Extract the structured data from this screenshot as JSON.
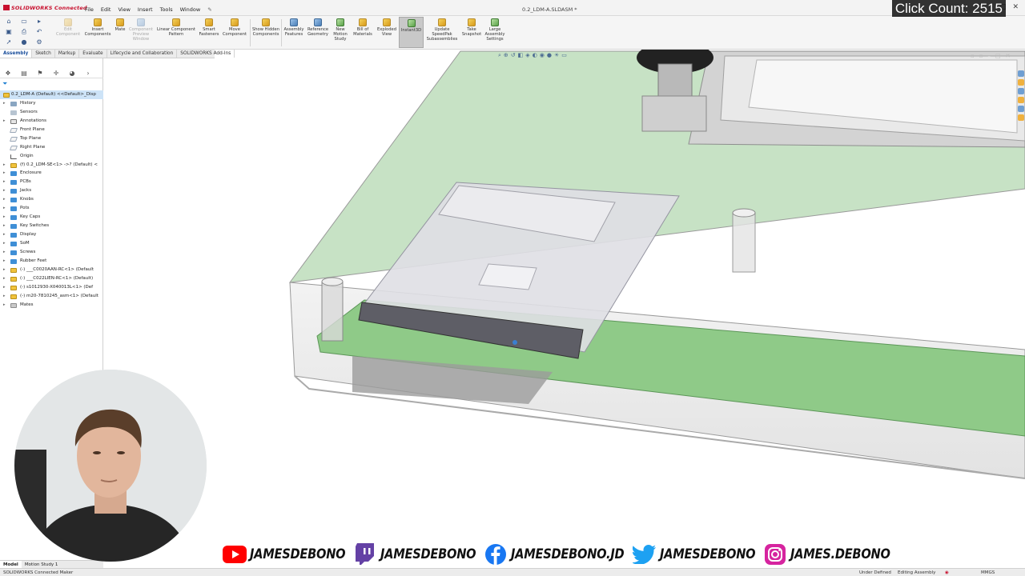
{
  "app": {
    "brand": "SOLIDWORKS Connected",
    "document_title": "0.2_LDM-A.SLDASM *",
    "menus": [
      "File",
      "Edit",
      "View",
      "Insert",
      "Tools",
      "Window"
    ]
  },
  "overlay": {
    "click_count": "Click Count: 2515"
  },
  "command_manager": {
    "buttons": [
      {
        "label": "Edit Component",
        "enabled": false
      },
      {
        "label": "Insert Components",
        "enabled": true
      },
      {
        "label": "Mate",
        "enabled": true
      },
      {
        "label": "Component Preview Window",
        "enabled": false
      },
      {
        "label": "Linear Component Pattern",
        "enabled": true
      },
      {
        "label": "Smart Fasteners",
        "enabled": true
      },
      {
        "label": "Move Component",
        "enabled": true
      },
      {
        "label": "Show Hidden Components",
        "enabled": true
      },
      {
        "label": "Assembly Features",
        "enabled": true
      },
      {
        "label": "Reference Geometry",
        "enabled": true
      },
      {
        "label": "New Motion Study",
        "enabled": true
      },
      {
        "label": "Bill of Materials",
        "enabled": true
      },
      {
        "label": "Exploded View",
        "enabled": true
      },
      {
        "label": "Instant3D",
        "enabled": true,
        "active": true
      },
      {
        "label": "Update SpeedPak Subassemblies",
        "enabled": true
      },
      {
        "label": "Take Snapshot",
        "enabled": true
      },
      {
        "label": "Large Assembly Settings",
        "enabled": true
      }
    ],
    "tabs": [
      "Assembly",
      "Sketch",
      "Markup",
      "Evaluate",
      "Lifecycle and Collaboration",
      "SOLIDWORKS Add-Ins"
    ],
    "active_tab": "Assembly"
  },
  "feature_tree": {
    "root": "0.2_LDM-A (Default) <<Default>_Disp",
    "items": [
      {
        "label": "History",
        "icon": "history-icon"
      },
      {
        "label": "Sensors",
        "icon": "sensors-icon"
      },
      {
        "label": "Annotations",
        "icon": "annotations-icon"
      },
      {
        "label": "Front Plane",
        "icon": "plane-icon"
      },
      {
        "label": "Top Plane",
        "icon": "plane-icon"
      },
      {
        "label": "Right Plane",
        "icon": "plane-icon"
      },
      {
        "label": "Origin",
        "icon": "origin-icon"
      },
      {
        "label": "(f) 0.2_LDM-SE<1> ->? (Default) <",
        "icon": "assembly-icon"
      },
      {
        "label": "Enclosure",
        "icon": "folder-icon"
      },
      {
        "label": "PCBs",
        "icon": "folder-icon"
      },
      {
        "label": "Jacks",
        "icon": "folder-icon"
      },
      {
        "label": "Knobs",
        "icon": "folder-icon"
      },
      {
        "label": "Pots",
        "icon": "folder-icon"
      },
      {
        "label": "Key Caps",
        "icon": "folder-icon"
      },
      {
        "label": "Key Switches",
        "icon": "folder-icon"
      },
      {
        "label": "Display",
        "icon": "folder-icon"
      },
      {
        "label": "SoM",
        "icon": "folder-icon"
      },
      {
        "label": "Screws",
        "icon": "folder-icon"
      },
      {
        "label": "Rubber Feet",
        "icon": "folder-icon"
      },
      {
        "label": "(-) ___C0020AAN-RC<1> (Default",
        "icon": "assembly-icon"
      },
      {
        "label": "(-) ___C022LIEN-RC<1> (Default)",
        "icon": "assembly-icon"
      },
      {
        "label": "(-) s1012930-X040013L<1> (Def",
        "icon": "assembly-icon"
      },
      {
        "label": "(-) m20-7810245_asm<1> (Default",
        "icon": "assembly-icon"
      },
      {
        "label": "Mates",
        "icon": "mates-icon"
      }
    ]
  },
  "bottom_tabs": [
    "Model",
    "Motion Study 1"
  ],
  "status": {
    "left": "SOLIDWORKS Connected Maker",
    "constraint": "Under Defined",
    "mode": "Editing Assembly",
    "units": "MMGS"
  },
  "social": [
    {
      "platform": "youtube",
      "handle": "JAMESDEBONO",
      "color": "#ff0000"
    },
    {
      "platform": "twitch",
      "handle": "JAMESDEBONO",
      "color": "#6441a5"
    },
    {
      "platform": "facebook",
      "handle": "JAMESDEBONO.JD",
      "color": "#1877f2"
    },
    {
      "platform": "twitter",
      "handle": "JAMESDEBONO",
      "color": "#1da1f2"
    },
    {
      "platform": "instagram",
      "handle": "JAMES.DEBONO",
      "color": "#d6249f"
    }
  ],
  "colors": {
    "brand_red": "#c8102e",
    "pcb_green": "#8fca88",
    "selection_blue": "#cde3f7"
  }
}
